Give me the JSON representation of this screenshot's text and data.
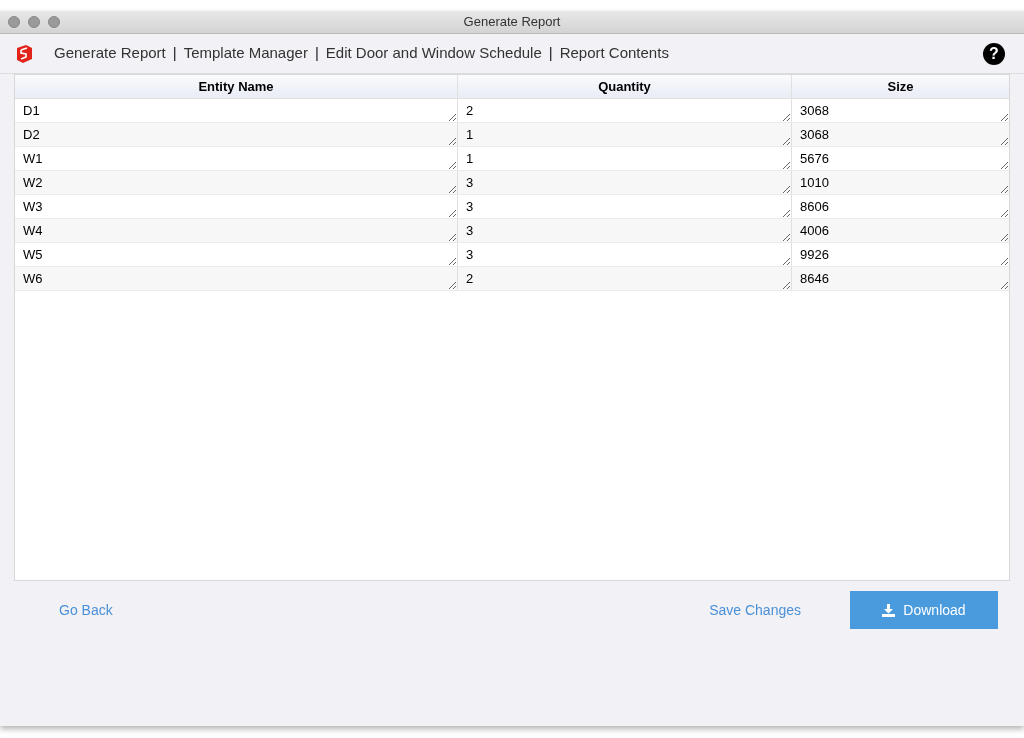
{
  "window": {
    "title": "Generate Report"
  },
  "nav": [
    {
      "kind": "link",
      "text": "Generate Report"
    },
    {
      "kind": "separator",
      "text": "|"
    },
    {
      "kind": "link",
      "text": "Template Manager"
    },
    {
      "kind": "separator",
      "text": "|"
    },
    {
      "kind": "link",
      "text": "Edit Door and Window Schedule"
    },
    {
      "kind": "separator",
      "text": "|"
    },
    {
      "kind": "link",
      "text": "Report Contents"
    }
  ],
  "help_icon": "?",
  "table": {
    "columns": [
      "Entity Name",
      "Quantity",
      "Size"
    ],
    "rows": [
      [
        "D1",
        "2",
        "3068"
      ],
      [
        "D2",
        "1",
        "3068"
      ],
      [
        "W1",
        "1",
        "5676"
      ],
      [
        "W2",
        "3",
        "1010"
      ],
      [
        "W3",
        "3",
        "8606"
      ],
      [
        "W4",
        "3",
        "4006"
      ],
      [
        "W5",
        "3",
        "9926"
      ],
      [
        "W6",
        "2",
        "8646"
      ]
    ]
  },
  "footer": {
    "back": "Go Back",
    "save": "Save Changes",
    "download": "Download"
  }
}
